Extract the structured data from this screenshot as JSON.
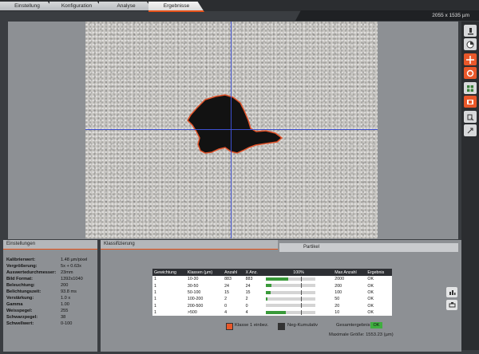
{
  "tabs": [
    {
      "label": "Einstellung",
      "active": false
    },
    {
      "label": "Konfiguration",
      "active": false
    },
    {
      "label": "Analyse",
      "active": false
    },
    {
      "label": "Ergebnisse",
      "active": true
    }
  ],
  "status": {
    "resolution": "2055 x 1535 µm"
  },
  "toolbar": {
    "icons": [
      "microscope-icon",
      "pie-icon",
      "crosshair-icon",
      "circle-icon",
      "grid-icon",
      "camera-icon",
      "edit-icon",
      "export-icon"
    ]
  },
  "settings": {
    "tab_label": "Einstellungen",
    "rows": [
      {
        "label": "Kalibrierwert:",
        "value": "1.48 µm/pixel"
      },
      {
        "label": "Vergrößerung:",
        "value": "5x + 0.63x"
      },
      {
        "label": "Auswertedurchmesser:",
        "value": "23mm"
      },
      {
        "label": "Bild Format:",
        "value": "1392x1040"
      },
      {
        "label": "Beleuchtung:",
        "value": "200"
      },
      {
        "label": "Belichtungszeit:",
        "value": "93.8 ms"
      },
      {
        "label": "Verstärkung:",
        "value": "1.0 x"
      },
      {
        "label": "Gamma",
        "value": "1.00"
      },
      {
        "label": "Weisspegel:",
        "value": "255"
      },
      {
        "label": "Schwarzpegel:",
        "value": "38"
      },
      {
        "label": "Schwellwert:",
        "value": "0-100"
      }
    ]
  },
  "classification": {
    "tab_label": "Klassifizierung",
    "tab2_label": "Partikel",
    "headers": [
      "Gewichtung",
      "Klassen (µm)",
      "Anzahl",
      "X Anz.",
      "100%",
      "Max Anzahl",
      "Ergebnis"
    ],
    "rows": [
      {
        "weight": "1",
        "klasse": "10-30",
        "anzahl": "883",
        "xanz": "883",
        "fill": 0.45,
        "max": "2000",
        "result": "OK"
      },
      {
        "weight": "1",
        "klasse": "30-50",
        "anzahl": "24",
        "xanz": "24",
        "fill": 0.12,
        "max": "200",
        "result": "OK"
      },
      {
        "weight": "1",
        "klasse": "50-100",
        "anzahl": "15",
        "xanz": "15",
        "fill": 0.1,
        "max": "100",
        "result": "OK"
      },
      {
        "weight": "1",
        "klasse": "100-200",
        "anzahl": "2",
        "xanz": "2",
        "fill": 0.04,
        "max": "50",
        "result": "OK"
      },
      {
        "weight": "1",
        "klasse": "200-500",
        "anzahl": "0",
        "xanz": "0",
        "fill": 0.0,
        "max": "20",
        "result": "OK"
      },
      {
        "weight": "1",
        "klasse": ">500",
        "anzahl": "4",
        "xanz": "4",
        "fill": 0.4,
        "max": "10",
        "result": "OK"
      }
    ],
    "checkbox1_label": "Klasse 1 einbez.",
    "checkbox2_label": "Neg-Kumulativ",
    "gesamt_label": "Gesamtergebnis:",
    "gesamt_value": "OK",
    "max_size": "Maximale Größe: 1553.23 (µm)"
  },
  "colors": {
    "accent": "#e9582a",
    "ok_green": "#3fae3f",
    "crosshair": "#3d4fd0"
  }
}
